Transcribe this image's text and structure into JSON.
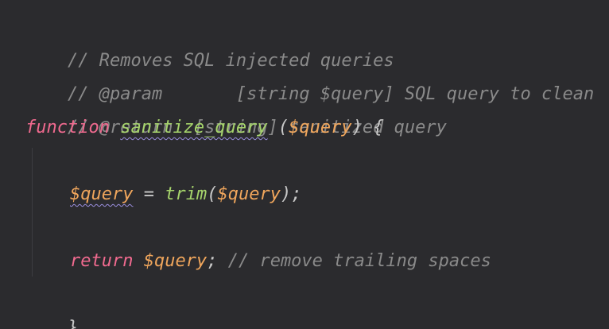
{
  "code": {
    "line1": {
      "comment": "// Removes SQL injected queries"
    },
    "line2": {
      "comment": "// @param       [string $query] SQL query to clean"
    },
    "line3": {
      "comment": "// @return  [string] sanitized query"
    },
    "line4": {
      "keyword": "function",
      "space1": " ",
      "name": "sanitize_query",
      "space2": " ",
      "open_paren": "(",
      "param": "$query",
      "close_paren_brace": ") {"
    },
    "line5": {
      "var": "$query",
      "assign": " = ",
      "call": "trim",
      "open_paren": "(",
      "arg": "$query",
      "close": ");"
    },
    "line6": {
      "keyword": "return",
      "space": " ",
      "var": "$query",
      "semi": ";",
      "comment": " // remove trailing spaces"
    },
    "line7": {
      "brace": "}"
    }
  },
  "colors": {
    "background": "#2b2b2e",
    "comment": "#8a8a8a",
    "keyword": "#f06a8f",
    "function": "#a5d36b",
    "variable": "#f0a65c",
    "punctuation": "#c8c8c8"
  }
}
